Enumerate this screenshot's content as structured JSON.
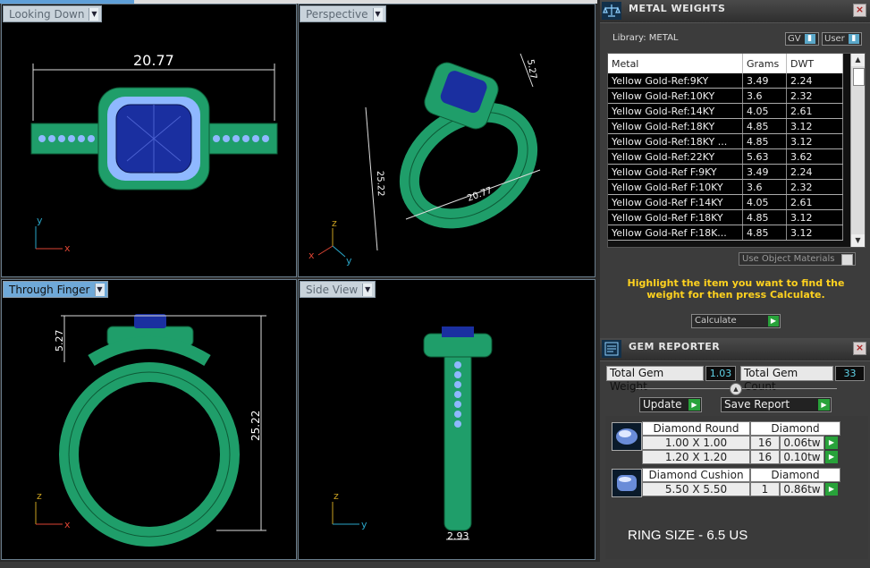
{
  "viewports": {
    "looking_down": {
      "label": "Looking Down",
      "dim_width": "20.77",
      "axis_a": "y",
      "axis_b": "x"
    },
    "perspective": {
      "label": "Perspective",
      "dim_top": "5.27",
      "dim_height": "25.22",
      "dim_width": "20.77",
      "axis_a": "z",
      "axis_b": "x",
      "axis_c": "y"
    },
    "through_finger": {
      "label": "Through Finger",
      "dim_top": "5.27",
      "dim_height": "25.22",
      "axis_a": "z",
      "axis_b": "x"
    },
    "side_view": {
      "label": "Side View",
      "dim_width": "2.93",
      "axis_a": "z",
      "axis_b": "y"
    }
  },
  "metal_weights": {
    "title": "METAL WEIGHTS",
    "library_label": "Library: METAL",
    "gv_label": "GV",
    "user_label": "User",
    "columns": [
      "Metal",
      "Grams",
      "DWT"
    ],
    "rows": [
      [
        "Yellow Gold-Ref:9KY",
        "3.49",
        "2.24"
      ],
      [
        "Yellow Gold-Ref:10KY",
        "3.6",
        "2.32"
      ],
      [
        "Yellow Gold-Ref:14KY",
        "4.05",
        "2.61"
      ],
      [
        "Yellow Gold-Ref:18KY",
        "4.85",
        "3.12"
      ],
      [
        "Yellow Gold-Ref:18KY ...",
        "4.85",
        "3.12"
      ],
      [
        "Yellow Gold-Ref:22KY",
        "5.63",
        "3.62"
      ],
      [
        "Yellow Gold-Ref F:9KY",
        "3.49",
        "2.24"
      ],
      [
        "Yellow Gold-Ref F:10KY",
        "3.6",
        "2.32"
      ],
      [
        "Yellow Gold-Ref F:14KY",
        "4.05",
        "2.61"
      ],
      [
        "Yellow Gold-Ref F:18KY",
        "4.85",
        "3.12"
      ],
      [
        "Yellow Gold-Ref F:18K...",
        "4.85",
        "3.12"
      ]
    ],
    "use_object_materials": "Use Object Materials",
    "hint": "Highlight the item you want to find the weight for then press Calculate.",
    "calculate_label": "Calculate"
  },
  "gem_reporter": {
    "title": "GEM REPORTER",
    "total_weight_label": "Total Gem Weight",
    "total_weight_value": "1.03",
    "total_count_label": "Total Gem Count",
    "total_count_value": "33",
    "update_label": "Update",
    "save_report_label": "Save Report",
    "groups": [
      {
        "shape": "Diamond Round",
        "material": "Diamond",
        "rows": [
          {
            "size": "1.00 X 1.00",
            "count": "16",
            "weight": "0.06tw"
          },
          {
            "size": "1.20 X 1.20",
            "count": "16",
            "weight": "0.10tw"
          }
        ]
      },
      {
        "shape": "Diamond Cushion",
        "material": "Diamond",
        "rows": [
          {
            "size": "5.50 X 5.50",
            "count": "1",
            "weight": "0.86tw"
          }
        ]
      }
    ]
  },
  "ring_size": "RING SIZE - 6.5 US",
  "colors": {
    "ring_green": "#1f9e6a",
    "stone_blue": "#1a2fa0",
    "accent_stone": "#8fb8ff",
    "active_tab": "#6fa9d8",
    "hint_yellow": "#ffd21f"
  }
}
